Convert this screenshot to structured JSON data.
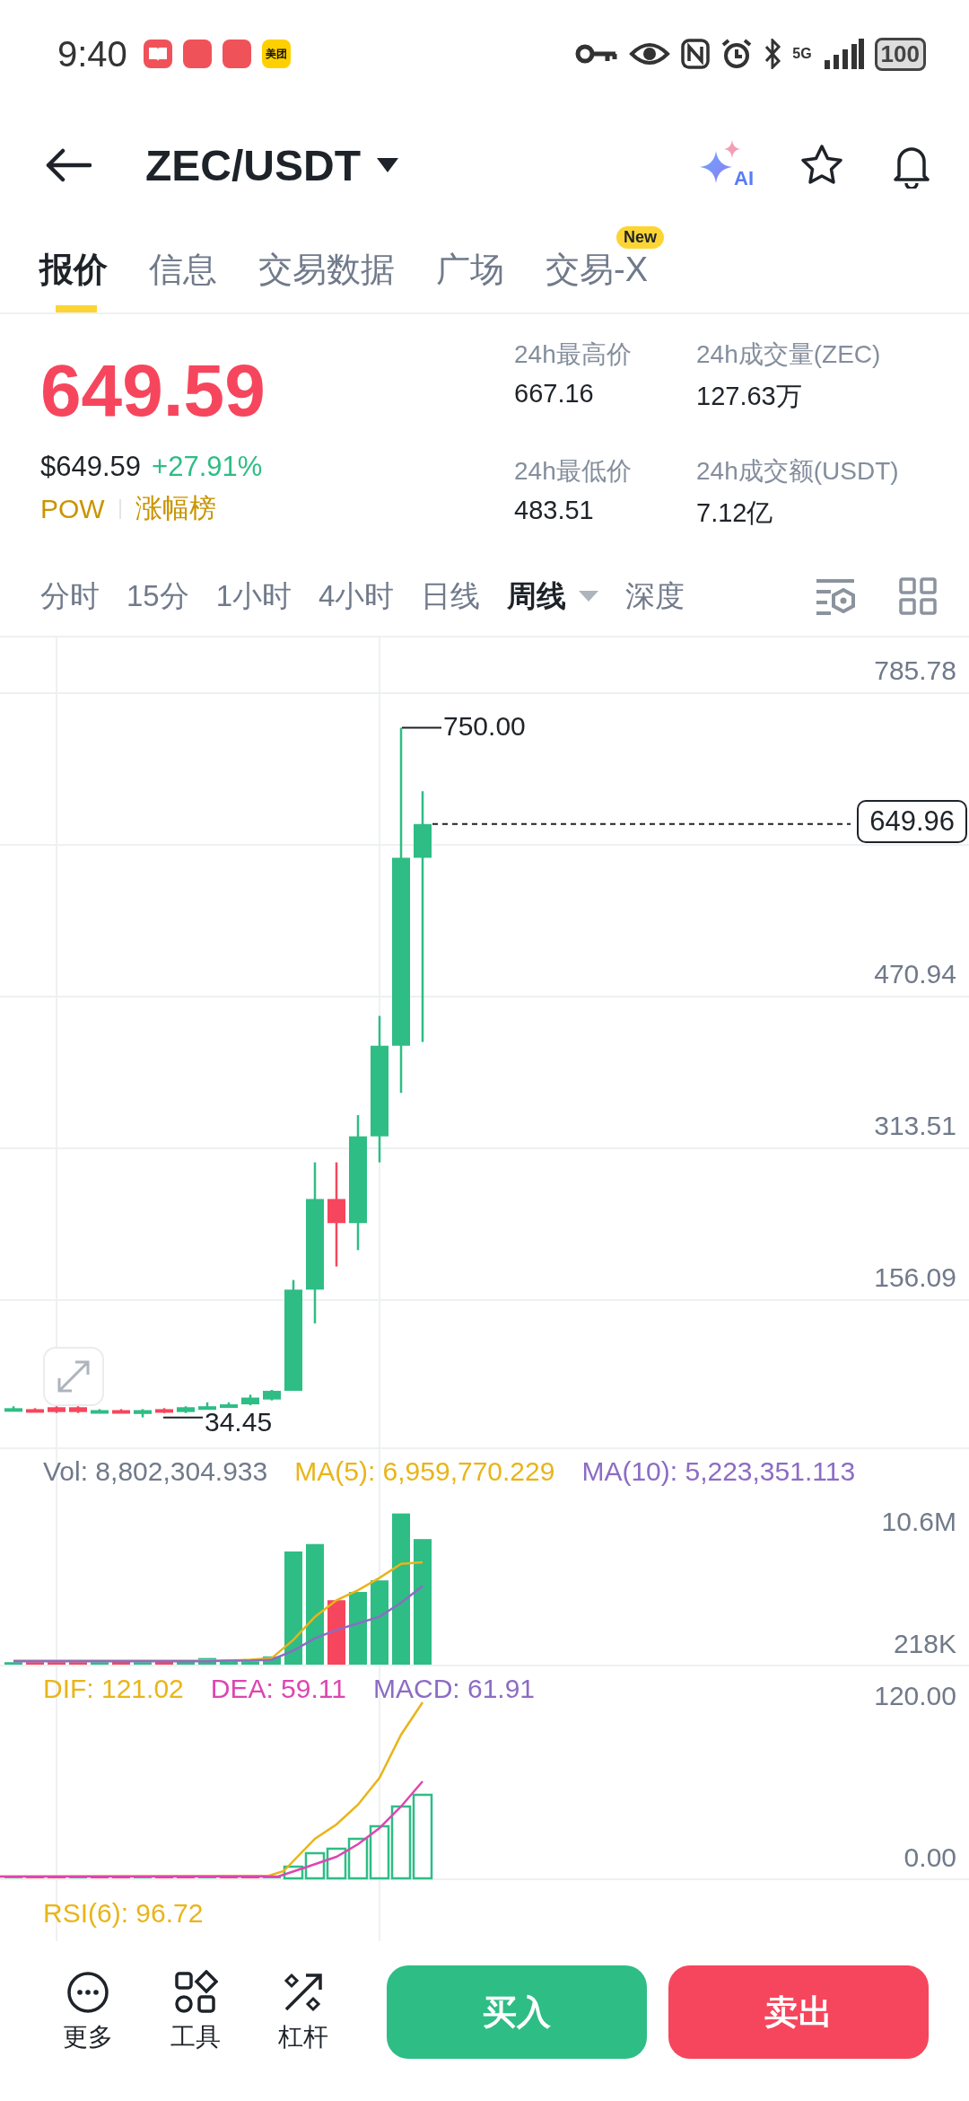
{
  "status_bar": {
    "time": "9:40",
    "apps": [
      {
        "kind": "book"
      },
      {
        "kind": "store"
      },
      {
        "kind": "store"
      },
      {
        "kind": "food",
        "label": "美团"
      }
    ],
    "network": "5G",
    "battery": "100"
  },
  "header": {
    "pair": "ZEC/USDT",
    "ai_label": "AI"
  },
  "tabs": [
    {
      "label": "报价",
      "selected": true
    },
    {
      "label": "信息",
      "selected": false
    },
    {
      "label": "交易数据",
      "selected": false
    },
    {
      "label": "广场",
      "selected": false
    },
    {
      "label": "交易-X",
      "selected": false,
      "badge": "New"
    }
  ],
  "price": {
    "last": "649.59",
    "usd": "$649.59",
    "change": "+27.91%",
    "tags": [
      "POW",
      "涨幅榜"
    ]
  },
  "stats": [
    {
      "label": "24h最高价",
      "value": "667.16"
    },
    {
      "label": "24h成交量(ZEC)",
      "value": "127.63万"
    },
    {
      "label": "24h最低价",
      "value": "483.51"
    },
    {
      "label": "24h成交额(USDT)",
      "value": "7.12亿"
    }
  ],
  "intervals": [
    {
      "label": "分时",
      "selected": false
    },
    {
      "label": "15分",
      "selected": false
    },
    {
      "label": "1小时",
      "selected": false
    },
    {
      "label": "4小时",
      "selected": false
    },
    {
      "label": "日线",
      "selected": false
    },
    {
      "label": "周线",
      "selected": true,
      "dropdown": true
    },
    {
      "label": "深度",
      "selected": false
    }
  ],
  "price_chart": {
    "axis_labels": [
      "785.78",
      "470.94",
      "313.51",
      "156.09"
    ],
    "high_marker": "750.00",
    "low_marker": "34.45",
    "last_price": "649.96"
  },
  "volume": {
    "legend": [
      {
        "text": "Vol: 8,802,304.933",
        "color": "#707a8a"
      },
      {
        "text": "MA(5): 6,959,770.229",
        "color": "#e8b519"
      },
      {
        "text": "MA(10): 5,223,351.113",
        "color": "#8c6cc4"
      }
    ],
    "axis_labels": [
      "10.6M",
      "218K"
    ]
  },
  "macd": {
    "legend": [
      {
        "text": "DIF: 121.02",
        "color": "#e8b519"
      },
      {
        "text": "DEA: 59.11",
        "color": "#dd46b0"
      },
      {
        "text": "MACD: 61.91",
        "color": "#8c6cc4"
      }
    ],
    "axis_labels": [
      "120.00",
      "0.00"
    ]
  },
  "rsi": {
    "legend": [
      {
        "text": "RSI(6): 96.72",
        "color": "#e8b519"
      }
    ]
  },
  "toolbar": [
    {
      "label": "更多",
      "kind": "more"
    },
    {
      "label": "工具",
      "kind": "tools"
    },
    {
      "label": "杠杆",
      "kind": "leverage"
    }
  ],
  "actions": [
    {
      "label": "买入",
      "kind": "buy"
    },
    {
      "label": "卖出",
      "kind": "sell"
    }
  ]
}
